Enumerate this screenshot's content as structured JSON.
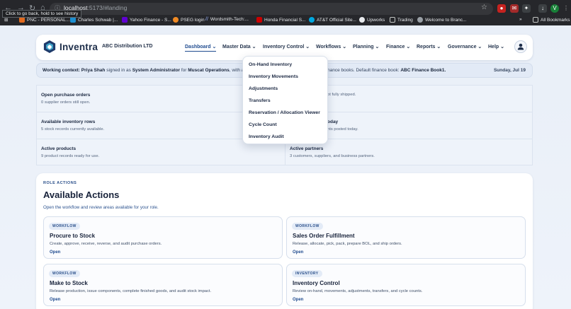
{
  "browser": {
    "url_host": "localhost",
    "url_rest": ":5173/#landing",
    "tooltip": "Click to go back, hold to see history",
    "profile_initial": "V",
    "bookmarks": [
      "PNC - PERSONAL...",
      "Charles Schwab |...",
      "Yahoo Finance - S...",
      "PSEG login",
      "Wordsmith-Tech:...",
      "Honda Financial S...",
      "AT&T Official Site...",
      "Upworks",
      "Trading",
      "Welcome to Branc..."
    ],
    "all_bookmarks": "All Bookmarks",
    "more": "»"
  },
  "header": {
    "brand": "Inventra",
    "org": "ABC Distribution LTD",
    "menu": [
      {
        "label": "Dashboard",
        "caret": "⌄"
      },
      {
        "label": "Master Data",
        "caret": "⌄"
      },
      {
        "label": "Inventory Control",
        "caret": "⌄"
      },
      {
        "label": "Workflows",
        "caret": "⌄"
      },
      {
        "label": "Planning",
        "caret": "⌄"
      },
      {
        "label": "Finance",
        "caret": "⌄"
      },
      {
        "label": "Reports",
        "caret": "⌄"
      },
      {
        "label": "Governance",
        "caret": "⌄"
      },
      {
        "label": "Help",
        "caret": "⌄"
      }
    ]
  },
  "context": {
    "prefix": "Working context:",
    "user": "Priya Shah",
    "signed": "signed in as",
    "role": "System Administrator",
    "for": "for",
    "unit": "Muscat Operations",
    "with": ", with acce",
    "tail": "nance books. Default finance book:",
    "book": "ABC Finance Book1.",
    "date": "Sunday, Jul 19"
  },
  "stats": [
    {
      "label": "Open purchase orders",
      "desc": "0 supplier orders still open."
    },
    {
      "label": "",
      "desc": "ot fully shipped."
    },
    {
      "label": "Available inventory rows",
      "desc": "5 stock records currently available."
    },
    {
      "label": "oday",
      "desc": "nts posted today."
    },
    {
      "label": "Active products",
      "desc": "9 product records ready for use."
    },
    {
      "label": "Active partners",
      "desc": "3 customers, suppliers, and business partners."
    }
  ],
  "actions": {
    "eyebrow": "ROLE ACTIONS",
    "title": "Available Actions",
    "subtitle": "Open the workflow and review areas available for your role.",
    "cards": [
      {
        "tag": "WORKFLOW",
        "title": "Procure to Stock",
        "desc": "Create, approve, receive, reverse, and audit purchase orders.",
        "open": "Open"
      },
      {
        "tag": "WORKFLOW",
        "title": "Sales Order Fulfillment",
        "desc": "Release, allocate, pick, pack, prepare BOL, and ship orders.",
        "open": "Open"
      },
      {
        "tag": "WORKFLOW",
        "title": "Make to Stock",
        "desc": "Release production, issue components, complete finished goods, and audit stock impact.",
        "open": "Open"
      },
      {
        "tag": "INVENTORY",
        "title": "Inventory Control",
        "desc": "Review on-hand, movements, adjustments, transfers, and cycle counts.",
        "open": "Open"
      }
    ]
  },
  "dropdown": [
    "On-Hand Inventory",
    "Inventory Movements",
    "Adjustments",
    "Transfers",
    "Reservation / Allocation Viewer",
    "Cycle Count",
    "Inventory Audit"
  ]
}
